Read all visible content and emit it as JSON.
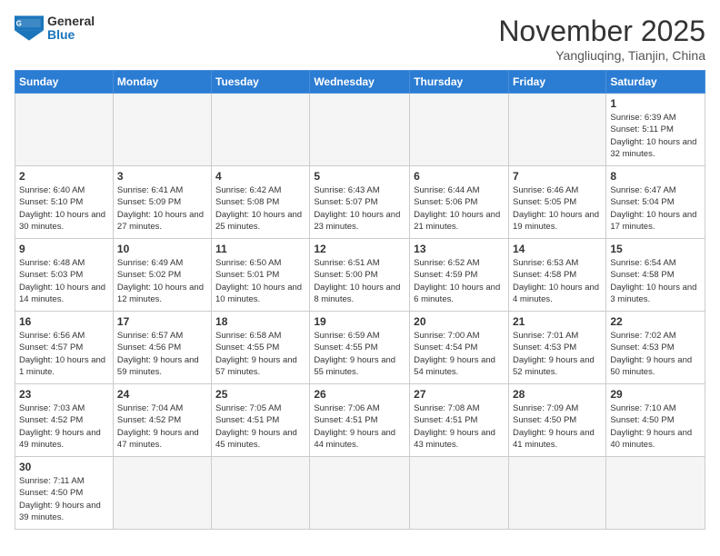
{
  "header": {
    "logo_general": "General",
    "logo_blue": "Blue",
    "month_title": "November 2025",
    "subtitle": "Yangliuqing, Tianjin, China"
  },
  "weekdays": [
    "Sunday",
    "Monday",
    "Tuesday",
    "Wednesday",
    "Thursday",
    "Friday",
    "Saturday"
  ],
  "weeks": [
    [
      {
        "day": "",
        "info": ""
      },
      {
        "day": "",
        "info": ""
      },
      {
        "day": "",
        "info": ""
      },
      {
        "day": "",
        "info": ""
      },
      {
        "day": "",
        "info": ""
      },
      {
        "day": "",
        "info": ""
      },
      {
        "day": "1",
        "info": "Sunrise: 6:39 AM\nSunset: 5:11 PM\nDaylight: 10 hours and 32 minutes."
      }
    ],
    [
      {
        "day": "2",
        "info": "Sunrise: 6:40 AM\nSunset: 5:10 PM\nDaylight: 10 hours and 30 minutes."
      },
      {
        "day": "3",
        "info": "Sunrise: 6:41 AM\nSunset: 5:09 PM\nDaylight: 10 hours and 27 minutes."
      },
      {
        "day": "4",
        "info": "Sunrise: 6:42 AM\nSunset: 5:08 PM\nDaylight: 10 hours and 25 minutes."
      },
      {
        "day": "5",
        "info": "Sunrise: 6:43 AM\nSunset: 5:07 PM\nDaylight: 10 hours and 23 minutes."
      },
      {
        "day": "6",
        "info": "Sunrise: 6:44 AM\nSunset: 5:06 PM\nDaylight: 10 hours and 21 minutes."
      },
      {
        "day": "7",
        "info": "Sunrise: 6:46 AM\nSunset: 5:05 PM\nDaylight: 10 hours and 19 minutes."
      },
      {
        "day": "8",
        "info": "Sunrise: 6:47 AM\nSunset: 5:04 PM\nDaylight: 10 hours and 17 minutes."
      }
    ],
    [
      {
        "day": "9",
        "info": "Sunrise: 6:48 AM\nSunset: 5:03 PM\nDaylight: 10 hours and 14 minutes."
      },
      {
        "day": "10",
        "info": "Sunrise: 6:49 AM\nSunset: 5:02 PM\nDaylight: 10 hours and 12 minutes."
      },
      {
        "day": "11",
        "info": "Sunrise: 6:50 AM\nSunset: 5:01 PM\nDaylight: 10 hours and 10 minutes."
      },
      {
        "day": "12",
        "info": "Sunrise: 6:51 AM\nSunset: 5:00 PM\nDaylight: 10 hours and 8 minutes."
      },
      {
        "day": "13",
        "info": "Sunrise: 6:52 AM\nSunset: 4:59 PM\nDaylight: 10 hours and 6 minutes."
      },
      {
        "day": "14",
        "info": "Sunrise: 6:53 AM\nSunset: 4:58 PM\nDaylight: 10 hours and 4 minutes."
      },
      {
        "day": "15",
        "info": "Sunrise: 6:54 AM\nSunset: 4:58 PM\nDaylight: 10 hours and 3 minutes."
      }
    ],
    [
      {
        "day": "16",
        "info": "Sunrise: 6:56 AM\nSunset: 4:57 PM\nDaylight: 10 hours and 1 minute."
      },
      {
        "day": "17",
        "info": "Sunrise: 6:57 AM\nSunset: 4:56 PM\nDaylight: 9 hours and 59 minutes."
      },
      {
        "day": "18",
        "info": "Sunrise: 6:58 AM\nSunset: 4:55 PM\nDaylight: 9 hours and 57 minutes."
      },
      {
        "day": "19",
        "info": "Sunrise: 6:59 AM\nSunset: 4:55 PM\nDaylight: 9 hours and 55 minutes."
      },
      {
        "day": "20",
        "info": "Sunrise: 7:00 AM\nSunset: 4:54 PM\nDaylight: 9 hours and 54 minutes."
      },
      {
        "day": "21",
        "info": "Sunrise: 7:01 AM\nSunset: 4:53 PM\nDaylight: 9 hours and 52 minutes."
      },
      {
        "day": "22",
        "info": "Sunrise: 7:02 AM\nSunset: 4:53 PM\nDaylight: 9 hours and 50 minutes."
      }
    ],
    [
      {
        "day": "23",
        "info": "Sunrise: 7:03 AM\nSunset: 4:52 PM\nDaylight: 9 hours and 49 minutes."
      },
      {
        "day": "24",
        "info": "Sunrise: 7:04 AM\nSunset: 4:52 PM\nDaylight: 9 hours and 47 minutes."
      },
      {
        "day": "25",
        "info": "Sunrise: 7:05 AM\nSunset: 4:51 PM\nDaylight: 9 hours and 45 minutes."
      },
      {
        "day": "26",
        "info": "Sunrise: 7:06 AM\nSunset: 4:51 PM\nDaylight: 9 hours and 44 minutes."
      },
      {
        "day": "27",
        "info": "Sunrise: 7:08 AM\nSunset: 4:51 PM\nDaylight: 9 hours and 43 minutes."
      },
      {
        "day": "28",
        "info": "Sunrise: 7:09 AM\nSunset: 4:50 PM\nDaylight: 9 hours and 41 minutes."
      },
      {
        "day": "29",
        "info": "Sunrise: 7:10 AM\nSunset: 4:50 PM\nDaylight: 9 hours and 40 minutes."
      }
    ],
    [
      {
        "day": "30",
        "info": "Sunrise: 7:11 AM\nSunset: 4:50 PM\nDaylight: 9 hours and 39 minutes."
      },
      {
        "day": "",
        "info": ""
      },
      {
        "day": "",
        "info": ""
      },
      {
        "day": "",
        "info": ""
      },
      {
        "day": "",
        "info": ""
      },
      {
        "day": "",
        "info": ""
      },
      {
        "day": "",
        "info": ""
      }
    ]
  ]
}
